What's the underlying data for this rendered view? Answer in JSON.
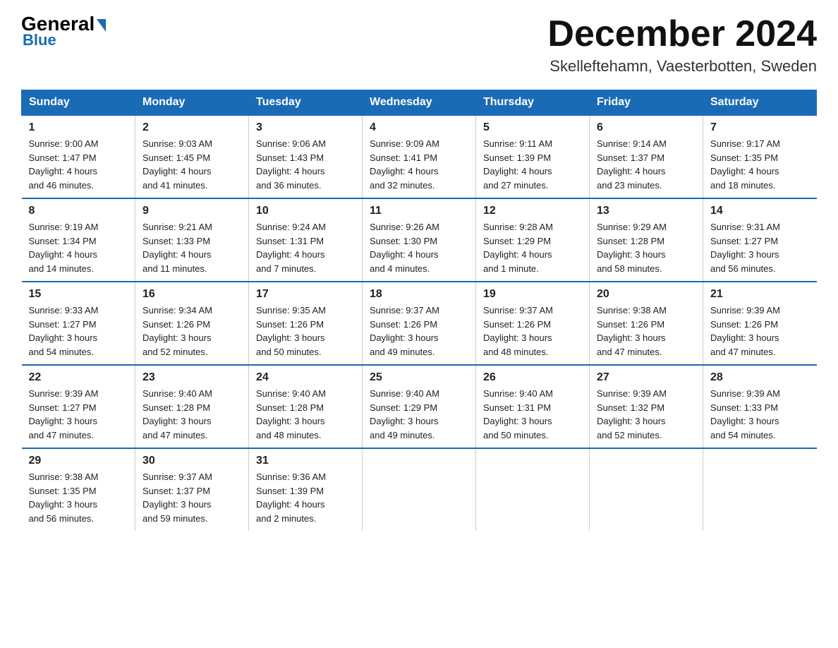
{
  "header": {
    "logo_general": "General",
    "logo_blue": "Blue",
    "month_title": "December 2024",
    "subtitle": "Skelleftehamn, Vaesterbotten, Sweden"
  },
  "days_of_week": [
    "Sunday",
    "Monday",
    "Tuesday",
    "Wednesday",
    "Thursday",
    "Friday",
    "Saturday"
  ],
  "weeks": [
    [
      {
        "day": "1",
        "info": "Sunrise: 9:00 AM\nSunset: 1:47 PM\nDaylight: 4 hours\nand 46 minutes."
      },
      {
        "day": "2",
        "info": "Sunrise: 9:03 AM\nSunset: 1:45 PM\nDaylight: 4 hours\nand 41 minutes."
      },
      {
        "day": "3",
        "info": "Sunrise: 9:06 AM\nSunset: 1:43 PM\nDaylight: 4 hours\nand 36 minutes."
      },
      {
        "day": "4",
        "info": "Sunrise: 9:09 AM\nSunset: 1:41 PM\nDaylight: 4 hours\nand 32 minutes."
      },
      {
        "day": "5",
        "info": "Sunrise: 9:11 AM\nSunset: 1:39 PM\nDaylight: 4 hours\nand 27 minutes."
      },
      {
        "day": "6",
        "info": "Sunrise: 9:14 AM\nSunset: 1:37 PM\nDaylight: 4 hours\nand 23 minutes."
      },
      {
        "day": "7",
        "info": "Sunrise: 9:17 AM\nSunset: 1:35 PM\nDaylight: 4 hours\nand 18 minutes."
      }
    ],
    [
      {
        "day": "8",
        "info": "Sunrise: 9:19 AM\nSunset: 1:34 PM\nDaylight: 4 hours\nand 14 minutes."
      },
      {
        "day": "9",
        "info": "Sunrise: 9:21 AM\nSunset: 1:33 PM\nDaylight: 4 hours\nand 11 minutes."
      },
      {
        "day": "10",
        "info": "Sunrise: 9:24 AM\nSunset: 1:31 PM\nDaylight: 4 hours\nand 7 minutes."
      },
      {
        "day": "11",
        "info": "Sunrise: 9:26 AM\nSunset: 1:30 PM\nDaylight: 4 hours\nand 4 minutes."
      },
      {
        "day": "12",
        "info": "Sunrise: 9:28 AM\nSunset: 1:29 PM\nDaylight: 4 hours\nand 1 minute."
      },
      {
        "day": "13",
        "info": "Sunrise: 9:29 AM\nSunset: 1:28 PM\nDaylight: 3 hours\nand 58 minutes."
      },
      {
        "day": "14",
        "info": "Sunrise: 9:31 AM\nSunset: 1:27 PM\nDaylight: 3 hours\nand 56 minutes."
      }
    ],
    [
      {
        "day": "15",
        "info": "Sunrise: 9:33 AM\nSunset: 1:27 PM\nDaylight: 3 hours\nand 54 minutes."
      },
      {
        "day": "16",
        "info": "Sunrise: 9:34 AM\nSunset: 1:26 PM\nDaylight: 3 hours\nand 52 minutes."
      },
      {
        "day": "17",
        "info": "Sunrise: 9:35 AM\nSunset: 1:26 PM\nDaylight: 3 hours\nand 50 minutes."
      },
      {
        "day": "18",
        "info": "Sunrise: 9:37 AM\nSunset: 1:26 PM\nDaylight: 3 hours\nand 49 minutes."
      },
      {
        "day": "19",
        "info": "Sunrise: 9:37 AM\nSunset: 1:26 PM\nDaylight: 3 hours\nand 48 minutes."
      },
      {
        "day": "20",
        "info": "Sunrise: 9:38 AM\nSunset: 1:26 PM\nDaylight: 3 hours\nand 47 minutes."
      },
      {
        "day": "21",
        "info": "Sunrise: 9:39 AM\nSunset: 1:26 PM\nDaylight: 3 hours\nand 47 minutes."
      }
    ],
    [
      {
        "day": "22",
        "info": "Sunrise: 9:39 AM\nSunset: 1:27 PM\nDaylight: 3 hours\nand 47 minutes."
      },
      {
        "day": "23",
        "info": "Sunrise: 9:40 AM\nSunset: 1:28 PM\nDaylight: 3 hours\nand 47 minutes."
      },
      {
        "day": "24",
        "info": "Sunrise: 9:40 AM\nSunset: 1:28 PM\nDaylight: 3 hours\nand 48 minutes."
      },
      {
        "day": "25",
        "info": "Sunrise: 9:40 AM\nSunset: 1:29 PM\nDaylight: 3 hours\nand 49 minutes."
      },
      {
        "day": "26",
        "info": "Sunrise: 9:40 AM\nSunset: 1:31 PM\nDaylight: 3 hours\nand 50 minutes."
      },
      {
        "day": "27",
        "info": "Sunrise: 9:39 AM\nSunset: 1:32 PM\nDaylight: 3 hours\nand 52 minutes."
      },
      {
        "day": "28",
        "info": "Sunrise: 9:39 AM\nSunset: 1:33 PM\nDaylight: 3 hours\nand 54 minutes."
      }
    ],
    [
      {
        "day": "29",
        "info": "Sunrise: 9:38 AM\nSunset: 1:35 PM\nDaylight: 3 hours\nand 56 minutes."
      },
      {
        "day": "30",
        "info": "Sunrise: 9:37 AM\nSunset: 1:37 PM\nDaylight: 3 hours\nand 59 minutes."
      },
      {
        "day": "31",
        "info": "Sunrise: 9:36 AM\nSunset: 1:39 PM\nDaylight: 4 hours\nand 2 minutes."
      },
      {
        "day": "",
        "info": ""
      },
      {
        "day": "",
        "info": ""
      },
      {
        "day": "",
        "info": ""
      },
      {
        "day": "",
        "info": ""
      }
    ]
  ]
}
